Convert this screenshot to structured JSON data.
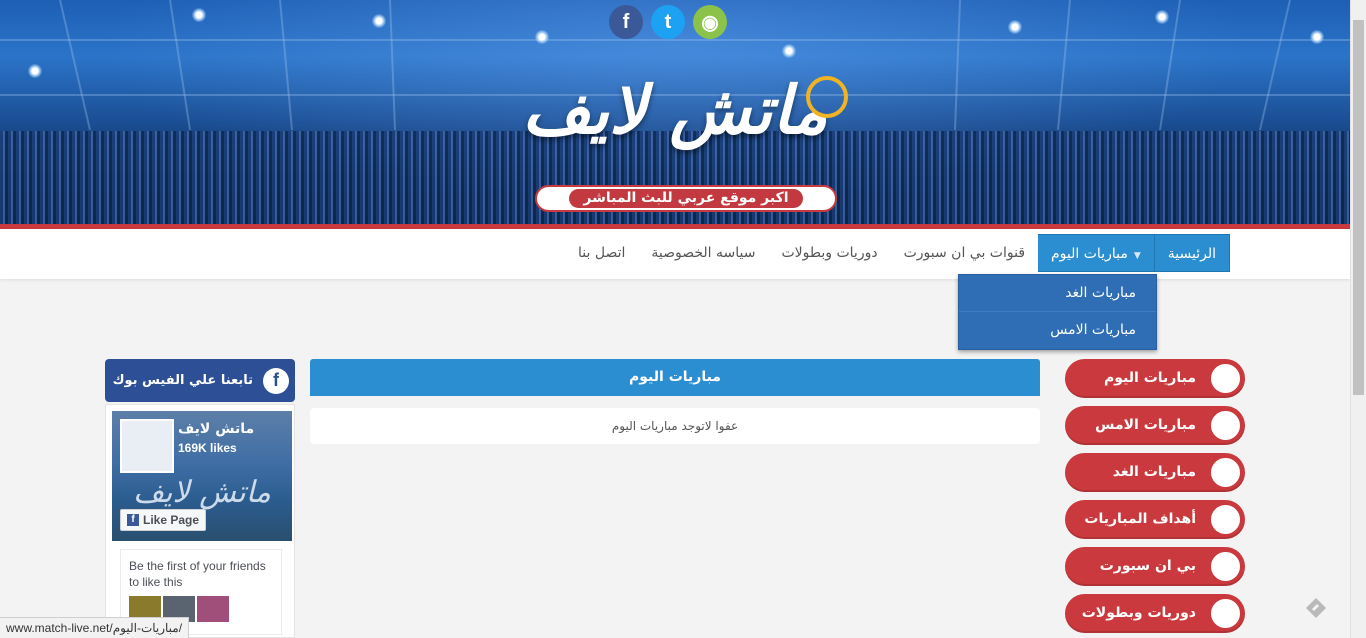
{
  "header": {
    "logo_text": "ماتش لايف",
    "tagline": "اكبر موقع عربي للبث المباشر",
    "social_icons": [
      "facebook-icon",
      "twitter-icon",
      "android-icon"
    ]
  },
  "nav": {
    "items": [
      {
        "label": "الرئيسية",
        "active": true
      },
      {
        "label": "مباريات اليوم",
        "active": true
      },
      {
        "label": "قنوات بي ان سبورت",
        "active": false
      },
      {
        "label": "دوريات وبطولات",
        "active": false
      },
      {
        "label": "سياسه الخصوصية",
        "active": false
      },
      {
        "label": "اتصل بنا",
        "active": false
      }
    ],
    "dropdown": [
      "مباريات الغد",
      "مباريات الامس"
    ]
  },
  "facebook_widget": {
    "title": "تابعنا علي الفيس بوك",
    "page_name": "ماتش لايف",
    "likes": "169K likes",
    "like_button": "Like Page",
    "friends_text": "Be the first of your friends to like this"
  },
  "main": {
    "title": "مباريات اليوم",
    "empty_message": "عفوا لاتوجد مباريات اليوم"
  },
  "sidebar": {
    "items": [
      "مباريات اليوم",
      "مباريات الامس",
      "مباريات الغد",
      "أهداف المباريات",
      "بي ان سبورت",
      "دوريات وبطولات"
    ]
  },
  "status_bar": {
    "url": "www.match-live.net/مباريات-اليوم/"
  },
  "colors": {
    "accent_blue": "#2a8ed0",
    "accent_red": "#c9393d",
    "facebook_blue": "#2d4f95"
  }
}
